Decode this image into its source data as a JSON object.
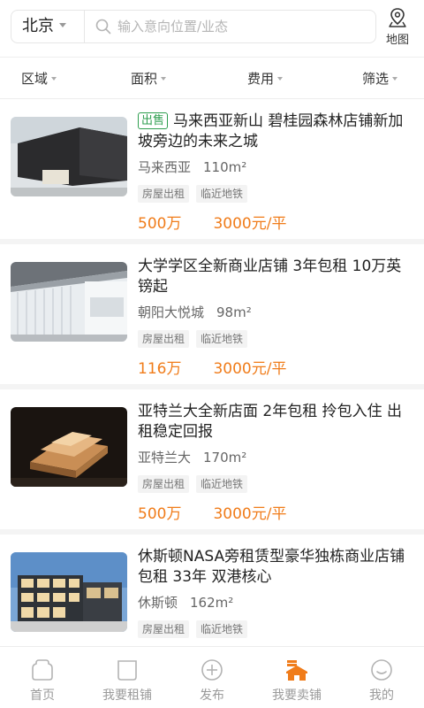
{
  "search": {
    "city": "北京",
    "placeholder": "输入意向位置/业态",
    "map_label": "地图"
  },
  "filters": [
    "区域",
    "面积",
    "费用",
    "筛选"
  ],
  "listings": [
    {
      "badge": "出售",
      "title": "马来西亚新山 碧桂园森林店铺新加坡旁边的未来之城",
      "location": "马来西亚",
      "area": "110m²",
      "tags": [
        "房屋出租",
        "临近地铁"
      ],
      "price": "500万",
      "unit_price": "3000元/平"
    },
    {
      "badge": "",
      "title": "大学学区全新商业店铺 3年包租 10万英镑起",
      "location": "朝阳大悦城",
      "area": "98m²",
      "tags": [
        "房屋出租",
        "临近地铁"
      ],
      "price": "116万",
      "unit_price": "3000元/平"
    },
    {
      "badge": "",
      "title": "亚特兰大全新店面 2年包租 拎包入住 出租稳定回报",
      "location": "亚特兰大",
      "area": "170m²",
      "tags": [
        "房屋出租",
        "临近地铁"
      ],
      "price": "500万",
      "unit_price": "3000元/平"
    },
    {
      "badge": "",
      "title": "休斯顿NASA旁租赁型豪华独栋商业店铺包租 33年 双港核心",
      "location": "休斯顿",
      "area": "162m²",
      "tags": [
        "房屋出租",
        "临近地铁"
      ],
      "price": "",
      "unit_price": ""
    }
  ],
  "tabs": [
    {
      "label": "首页",
      "icon": "home-icon"
    },
    {
      "label": "我要租铺",
      "icon": "shop-icon"
    },
    {
      "label": "发布",
      "icon": "plus-icon"
    },
    {
      "label": "我要卖铺",
      "icon": "sell-shop-icon"
    },
    {
      "label": "我的",
      "icon": "profile-icon"
    }
  ],
  "colors": {
    "accent": "#f07c1a",
    "sale_badge": "#2e9e4f",
    "muted": "#9a9a9a"
  }
}
